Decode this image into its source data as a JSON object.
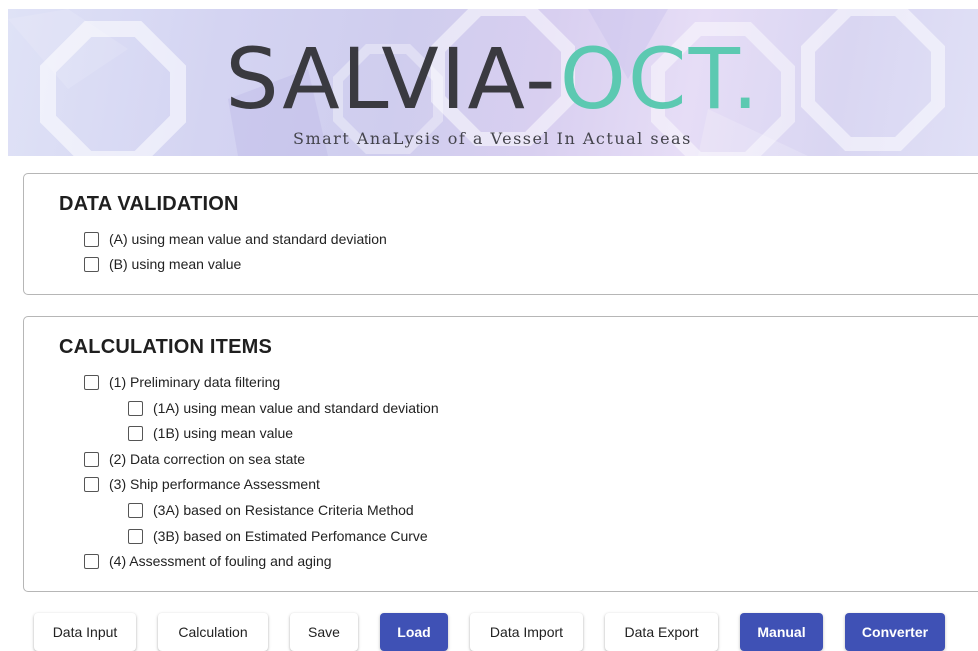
{
  "banner": {
    "title_main": "SALVIA",
    "title_sep": "-",
    "title_accent": "OCT.",
    "subtitle": "Smart AnaLysis of a Vessel In Actual seas"
  },
  "data_validation": {
    "title": "DATA VALIDATION",
    "options": [
      {
        "label": "(A) using mean value and standard deviation",
        "checked": false
      },
      {
        "label": "(B) using mean value",
        "checked": false
      }
    ]
  },
  "calculation_items": {
    "title": "CALCULATION ITEMS",
    "options": [
      {
        "label": "(1) Preliminary data filtering",
        "checked": false
      },
      {
        "label": "(1A) using mean value and standard deviation",
        "checked": false
      },
      {
        "label": "(1B) using mean value",
        "checked": false
      },
      {
        "label": "(2) Data correction on sea state",
        "checked": false
      },
      {
        "label": "(3) Ship performance Assessment",
        "checked": false
      },
      {
        "label": "(3A) based on Resistance Criteria Method",
        "checked": false
      },
      {
        "label": "(3B) based on Estimated Perfomance Curve",
        "checked": false
      },
      {
        "label": "(4) Assessment of fouling and aging",
        "checked": false
      }
    ]
  },
  "toolbar": {
    "data_input": "Data Input",
    "calculation": "Calculation",
    "save": "Save",
    "load": "Load",
    "data_import": "Data Import",
    "data_export": "Data Export",
    "manual": "Manual",
    "converter": "Converter"
  },
  "colors": {
    "primary_button": "#3f51b5",
    "logo_accent": "#5cc9b1"
  }
}
